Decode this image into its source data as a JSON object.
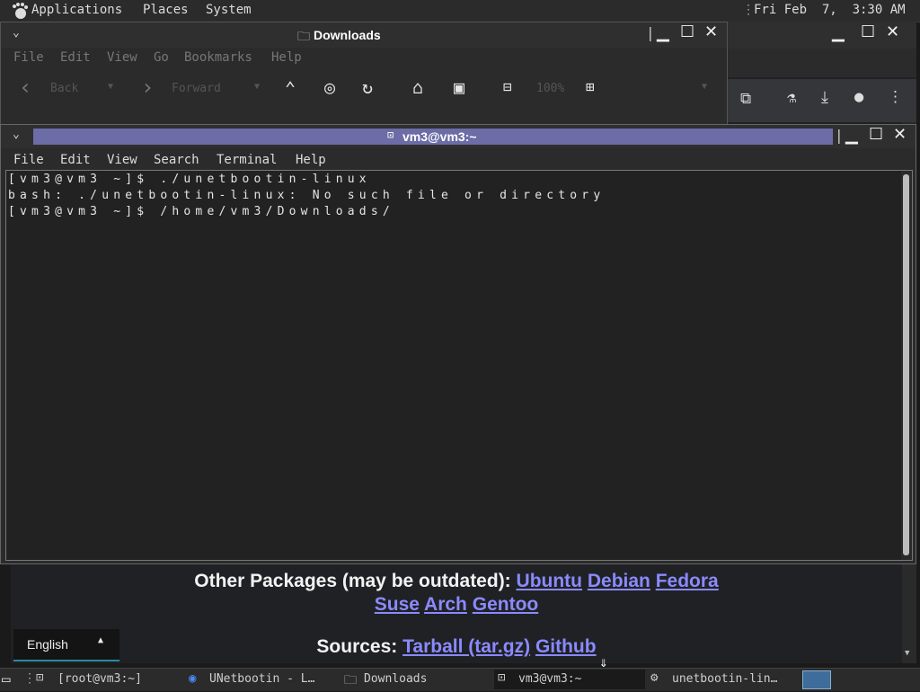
{
  "top_panel": {
    "applications": "Applications",
    "places": "Places",
    "system": "System",
    "clock": "Fri Feb  7,  3:30 AM"
  },
  "file_manager": {
    "title": "Downloads",
    "menu": [
      "File",
      "Edit",
      "View",
      "Go",
      "Bookmarks",
      "Help"
    ],
    "back": "Back",
    "forward": "Forward",
    "zoom": "100%"
  },
  "terminal": {
    "title": "vm3@vm3:~",
    "menu": [
      "File",
      "Edit",
      "View",
      "Search",
      "Terminal",
      "Help"
    ],
    "lines": [
      "[vm3@vm3 ~]$ ./unetbootin-linux",
      "bash: ./unetbootin-linux: No such file or directory",
      "[vm3@vm3 ~]$ /home/vm3/Downloads/"
    ]
  },
  "webpage": {
    "other_packages_label": "Other Packages (may be outdated):",
    "packages": [
      "Ubuntu",
      "Debian",
      "Fedora",
      "Suse",
      "Arch",
      "Gentoo"
    ],
    "sources_label": "Sources:",
    "sources": [
      "Tarball (tar.gz)",
      "Github"
    ],
    "language": "English"
  },
  "taskbar": {
    "tasks": [
      "[root@vm3:~]",
      "UNetbootin - L…",
      "Downloads",
      "vm3@vm3:~",
      "unetbootin-lin…"
    ]
  }
}
